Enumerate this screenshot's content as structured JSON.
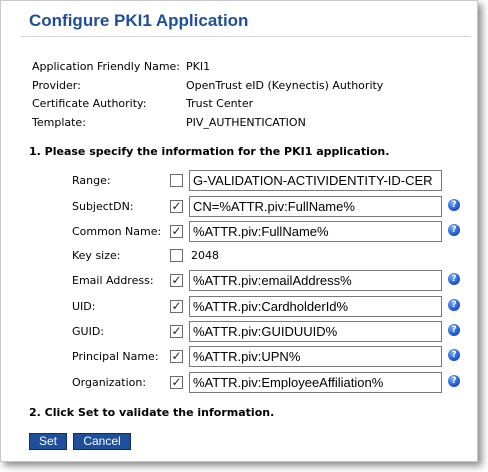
{
  "title": "Configure PKI1 Application",
  "info": [
    {
      "label": "Application Friendly Name:",
      "value": "PKI1"
    },
    {
      "label": "Provider:",
      "value": "OpenTrust eID (Keynectis) Authority"
    },
    {
      "label": "Certificate Authority:",
      "value": "Trust Center"
    },
    {
      "label": "Template:",
      "value": "PIV_AUTHENTICATION"
    }
  ],
  "section1": "1. Please specify the information for the PKI1 application.",
  "fields": {
    "range": {
      "label": "Range:",
      "checked": false,
      "value": "G-VALIDATION-ACTIVIDENTITY-ID-CER"
    },
    "subjectdn": {
      "label": "SubjectDN:",
      "checked": true,
      "value": "CN=%ATTR.piv:FullName%"
    },
    "common_name": {
      "label": "Common Name:",
      "checked": true,
      "value": "%ATTR.piv:FullName%"
    },
    "key_size": {
      "label": "Key size:",
      "checked": false,
      "value": "2048"
    },
    "email": {
      "label": "Email Address:",
      "checked": true,
      "value": "%ATTR.piv:emailAddress%"
    },
    "uid": {
      "label": "UID:",
      "checked": true,
      "value": "%ATTR.piv:CardholderId%"
    },
    "guid": {
      "label": "GUID:",
      "checked": true,
      "value": "%ATTR.piv:GUIDUUID%"
    },
    "principal_name": {
      "label": "Principal Name:",
      "checked": true,
      "value": "%ATTR.piv:UPN%"
    },
    "organization": {
      "label": "Organization:",
      "checked": true,
      "value": "%ATTR.piv:EmployeeAffiliation%"
    }
  },
  "help_glyph": "?",
  "check_glyph": "✓",
  "section2": "2. Click Set to validate the information.",
  "buttons": {
    "set": "Set",
    "cancel": "Cancel"
  },
  "colors": {
    "title": "#1f4e9a",
    "button": "#1f4e9a",
    "help_icon": "#1a4fc4"
  }
}
